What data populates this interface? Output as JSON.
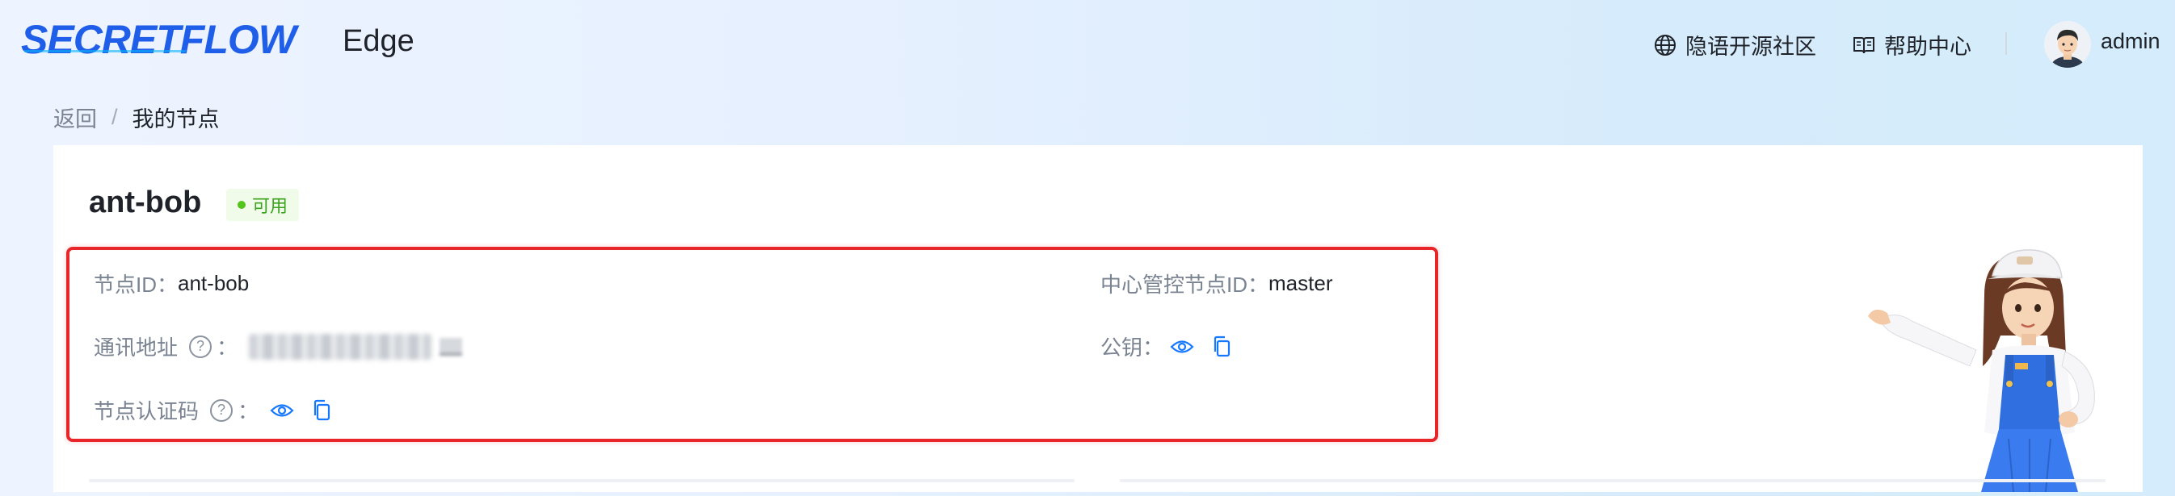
{
  "header": {
    "logo_text": "SECRETFLOW",
    "product_name": "Edge",
    "nav": [
      {
        "label": "隐语开源社区",
        "icon": "globe-icon"
      },
      {
        "label": "帮助中心",
        "icon": "book-icon"
      }
    ],
    "user": {
      "name": "admin",
      "avatar": "avatar"
    }
  },
  "breadcrumb": {
    "back": "返回",
    "separator": "/",
    "current": "我的节点"
  },
  "node": {
    "name": "ant-bob",
    "status": "可用",
    "status_color": "#52c41a",
    "fields": {
      "node_id_label": "节点ID：",
      "node_id_value": "ant-bob",
      "address_label": "通讯地址",
      "address_help": "?",
      "address_colon": "：",
      "cert_label": "节点认证码",
      "cert_help": "?",
      "cert_colon": "：",
      "master_label": "中心管控节点ID：",
      "master_value": "master",
      "pubkey_label": "公钥："
    }
  },
  "colors": {
    "accent": "#1677ff",
    "highlight_border": "#e8262a"
  }
}
